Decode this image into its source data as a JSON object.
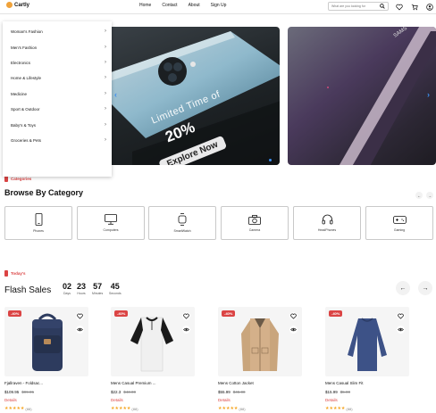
{
  "header": {
    "logo": "Cartly",
    "nav": [
      "Home",
      "Contact",
      "About",
      "Sign Up"
    ],
    "search_placeholder": "What are you looking for"
  },
  "sidebar": {
    "items": [
      {
        "label": "Woman's Fashion"
      },
      {
        "label": "Men's Fashion"
      },
      {
        "label": "Electronics"
      },
      {
        "label": "Home & Lifestyle"
      },
      {
        "label": "Medicine"
      },
      {
        "label": "Sport & Outdoor"
      },
      {
        "label": "Baby's & Toys"
      },
      {
        "label": "Groceries & Pets"
      }
    ]
  },
  "banner": {
    "headline": "Limited Time of",
    "discount": "20%",
    "cta": "Explore Now"
  },
  "categories": {
    "tag": "Categories",
    "title": "Browse By Category",
    "items": [
      {
        "label": "Phones",
        "icon": "phone-icon"
      },
      {
        "label": "Computers",
        "icon": "monitor-icon"
      },
      {
        "label": "SmartWatch",
        "icon": "smartwatch-icon"
      },
      {
        "label": "Camera",
        "icon": "camera-icon"
      },
      {
        "label": "HeadPhones",
        "icon": "headphones-icon"
      },
      {
        "label": "Gaming",
        "icon": "gamepad-icon"
      }
    ]
  },
  "flash": {
    "tag": "Today's",
    "title": "Flash Sales",
    "countdown": [
      {
        "num": "02",
        "unit": "Days"
      },
      {
        "num": "23",
        "unit": "Hours"
      },
      {
        "num": "57",
        "unit": "Minutes"
      },
      {
        "num": "45",
        "unit": "Seconds"
      }
    ]
  },
  "products": [
    {
      "name": "Fjallraven - Foldsac...",
      "price": "$109.95",
      "old": "$99.95",
      "discount": "-40%",
      "details": "Details",
      "rating": "(88)"
    },
    {
      "name": "Mens Casual Premium ...",
      "price": "$22.3",
      "old": "$43.00",
      "discount": "-40%",
      "details": "Details",
      "rating": "(88)"
    },
    {
      "name": "Mens Cotton Jacket",
      "price": "$55.99",
      "old": "$45.00",
      "discount": "-40%",
      "details": "Details",
      "rating": "(88)"
    },
    {
      "name": "Mens Casual Slim Fit",
      "price": "$15.99",
      "old": "$5.00",
      "discount": "-40%",
      "details": "Details",
      "rating": "(88)"
    }
  ],
  "colors": {
    "accent": "#db4444",
    "star": "#f5a623",
    "arrow": "#3c8ff0"
  }
}
